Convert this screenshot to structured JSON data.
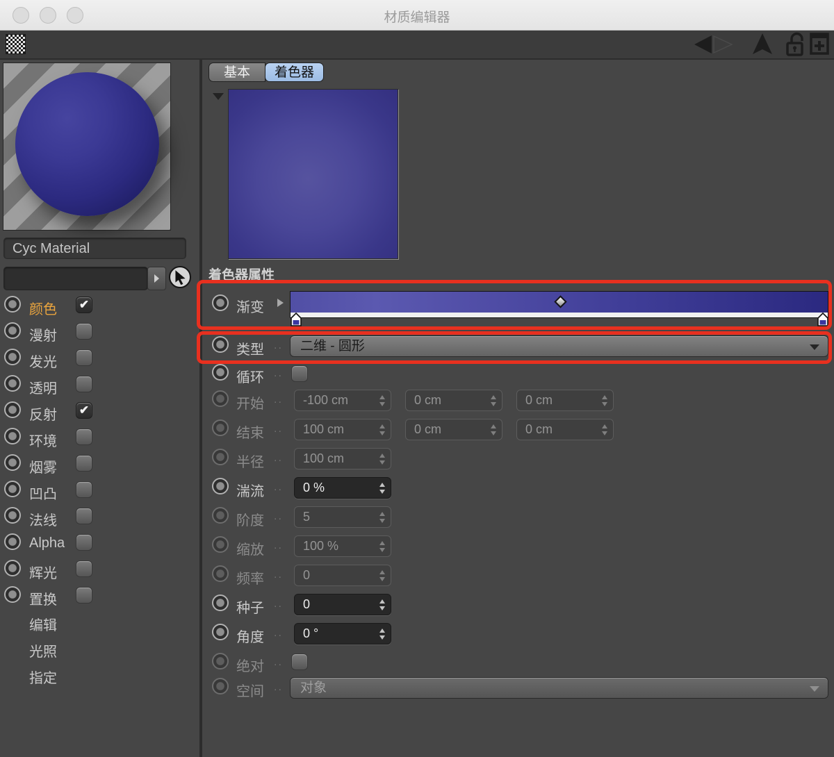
{
  "window": {
    "title": "材质编辑器"
  },
  "icons": {
    "check": "✔",
    "toolbar": [
      "pattern-swatch",
      "back-arrow",
      "forward-arrow",
      "up-arrow",
      "unlock",
      "add-material"
    ],
    "picker": "cursor-arrow"
  },
  "colors": {
    "highlight_red": "#e8301f",
    "active_tab_blue": "#a9c6e9",
    "channel_active_orange": "#e9a43e",
    "gradient_left": "#514fa5",
    "gradient_right": "#2b2980",
    "shader_preview_center": "#56539f",
    "shader_preview_edge": "#343080",
    "sphere_blue": "#2c2a80"
  },
  "material": {
    "name": "Cyc Material",
    "search_value": ""
  },
  "channels": {
    "items": [
      {
        "label": "颜色",
        "checked": true,
        "active": true
      },
      {
        "label": "漫射",
        "checked": false
      },
      {
        "label": "发光",
        "checked": false
      },
      {
        "label": "透明",
        "checked": false
      },
      {
        "label": "反射",
        "checked": true
      },
      {
        "label": "环境",
        "checked": false
      },
      {
        "label": "烟雾",
        "checked": false
      },
      {
        "label": "凹凸",
        "checked": false
      },
      {
        "label": "法线",
        "checked": false
      },
      {
        "label": "Alpha",
        "checked": false
      },
      {
        "label": "辉光",
        "checked": false
      },
      {
        "label": "置换",
        "checked": false
      },
      {
        "label": "编辑",
        "plain": true
      },
      {
        "label": "光照",
        "plain": true
      },
      {
        "label": "指定",
        "plain": true
      }
    ]
  },
  "tabs": [
    {
      "label": "基本",
      "active": false
    },
    {
      "label": "着色器",
      "active": true
    }
  ],
  "properties": {
    "title": "着色器属性",
    "dots": "..",
    "gradient": {
      "midpoint_position": "50%",
      "knots": [
        "0%",
        "100%"
      ]
    },
    "rows": [
      {
        "label": "渐变",
        "enabled": true,
        "widget": "gradient"
      },
      {
        "label": "类型",
        "enabled": true,
        "widget": "dropdown",
        "value": "二维 - 圆形"
      },
      {
        "label": "循环",
        "enabled": true,
        "widget": "checkbox",
        "checked": false
      },
      {
        "label": "开始",
        "enabled": false,
        "widget": "triple",
        "values": [
          "-100 cm",
          "0 cm",
          "0 cm"
        ]
      },
      {
        "label": "结束",
        "enabled": false,
        "widget": "triple",
        "values": [
          "100 cm",
          "0 cm",
          "0 cm"
        ]
      },
      {
        "label": "半径",
        "enabled": false,
        "widget": "single",
        "value": "100 cm"
      },
      {
        "label": "湍流",
        "enabled": true,
        "widget": "single",
        "value": "0 %"
      },
      {
        "label": "阶度",
        "enabled": false,
        "widget": "single",
        "value": "5"
      },
      {
        "label": "缩放",
        "enabled": false,
        "widget": "single",
        "value": "100 %"
      },
      {
        "label": "频率",
        "enabled": false,
        "widget": "single",
        "value": "0"
      },
      {
        "label": "种子",
        "enabled": true,
        "widget": "single",
        "value": "0"
      },
      {
        "label": "角度",
        "enabled": true,
        "widget": "single",
        "value": "0 °"
      },
      {
        "label": "绝对",
        "enabled": false,
        "widget": "checkbox",
        "checked": false
      },
      {
        "label": "空间",
        "enabled": false,
        "widget": "dropdown",
        "value": "对象"
      }
    ]
  }
}
